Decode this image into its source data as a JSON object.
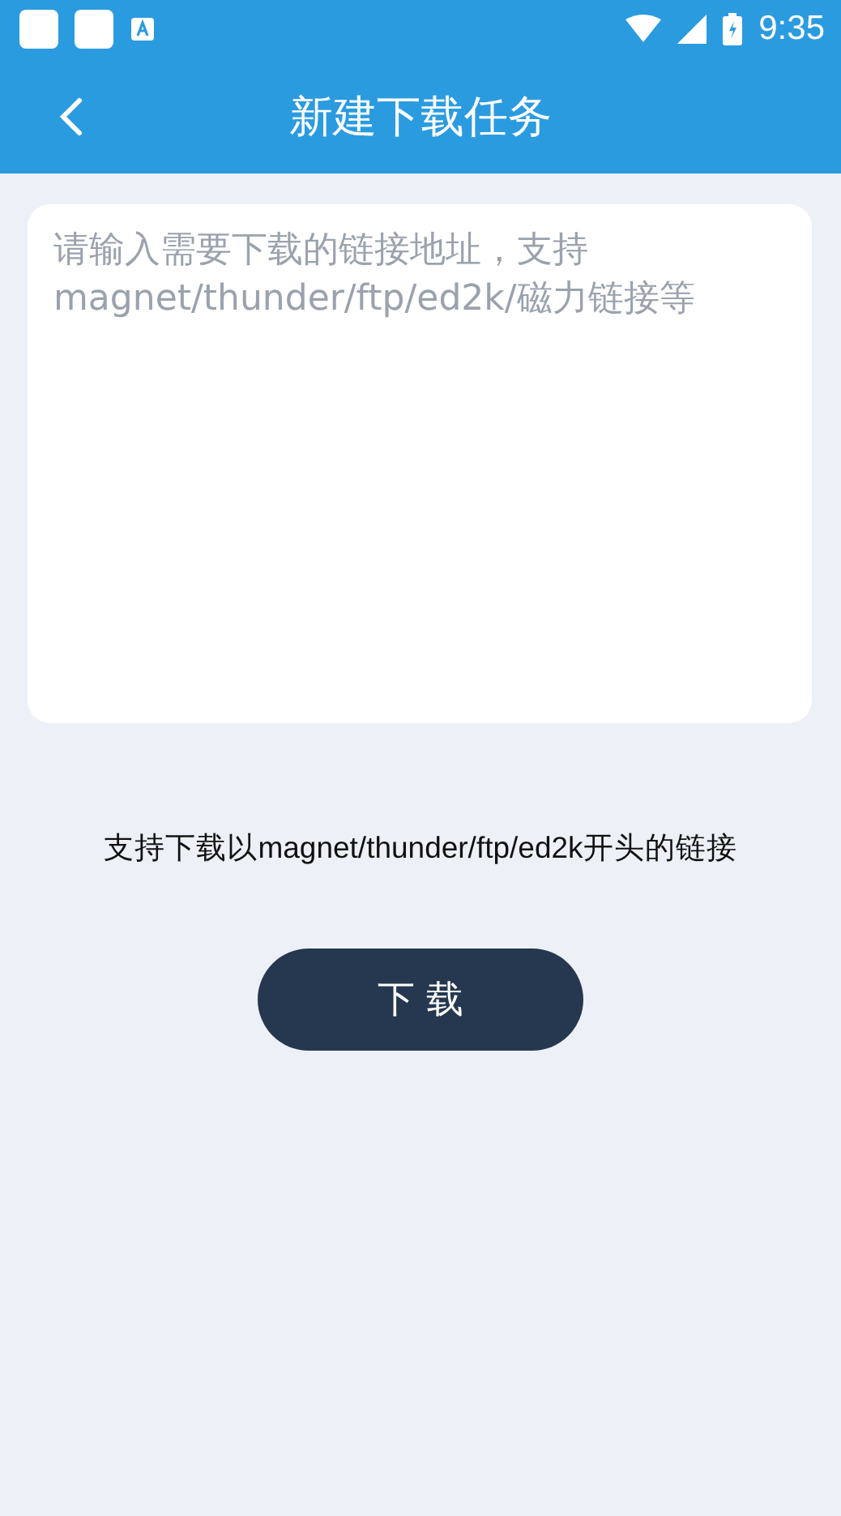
{
  "status_bar": {
    "time": "9:35"
  },
  "header": {
    "title": "新建下载任务"
  },
  "link_input": {
    "placeholder": "请输入需要下载的链接地址，支持magnet/thunder/ftp/ed2k/磁力链接等"
  },
  "hint": "支持下载以magnet/thunder/ftp/ed2k开头的链接",
  "download_button": {
    "label": "下 载"
  }
}
